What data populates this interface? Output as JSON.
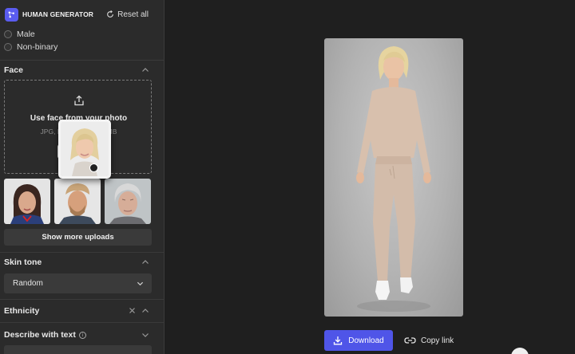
{
  "app": {
    "title": "HUMAN GENERATOR",
    "reset_label": "Reset all"
  },
  "gender": {
    "options": [
      "Male",
      "Non-binary"
    ]
  },
  "face": {
    "title": "Face",
    "upload_title": "Use face from your photo",
    "upload_hint": "JPG, PNG — max 10 MB",
    "show_more_label": "Show more uploads"
  },
  "skin_tone": {
    "title": "Skin tone",
    "selected": "Random"
  },
  "ethnicity": {
    "title": "Ethnicity"
  },
  "describe": {
    "title": "Describe with text"
  },
  "actions": {
    "download_label": "Download",
    "copy_label": "Copy link"
  },
  "colors": {
    "accent": "#4f55e8",
    "brand": "#5a5cf0",
    "sidebar_bg": "#2b2b2b",
    "main_bg": "#1f1f1f"
  },
  "icons": [
    "logo-icon",
    "reset-icon",
    "upload-icon",
    "chevron-up-icon",
    "chevron-down-icon",
    "close-icon",
    "info-icon",
    "download-icon",
    "link-icon"
  ]
}
